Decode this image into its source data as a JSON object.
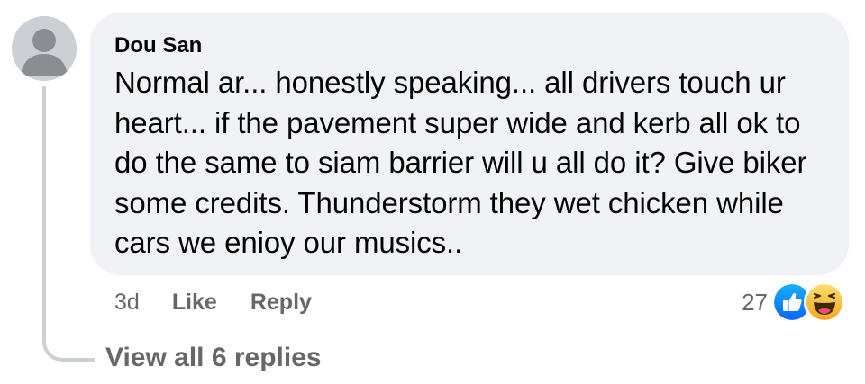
{
  "comment": {
    "author": "Dou San",
    "lines": [
      "Normal ar... honestly speaking... all drivers touch ur",
      "heart... if the pavement super wide and kerb all ok to",
      "do the same to siam barrier will u all do it? Give biker",
      "some credits. Thunderstorm they wet chicken while",
      "cars we enioy our musics.."
    ],
    "avatar_icon": "default-user-silhouette"
  },
  "actions": {
    "time": "3d",
    "like_label": "Like",
    "reply_label": "Reply"
  },
  "reactions": {
    "count": "27",
    "icons": [
      "like-reaction-icon",
      "haha-reaction-icon"
    ]
  },
  "replies": {
    "view_all_label": "View all 6 replies"
  },
  "colors": {
    "bubble_bg": "#f0f2f5",
    "secondary_text": "#65676b",
    "primary_text": "#050505",
    "like_blue": "#1877f2",
    "haha_yellow": "#f7c33b"
  }
}
